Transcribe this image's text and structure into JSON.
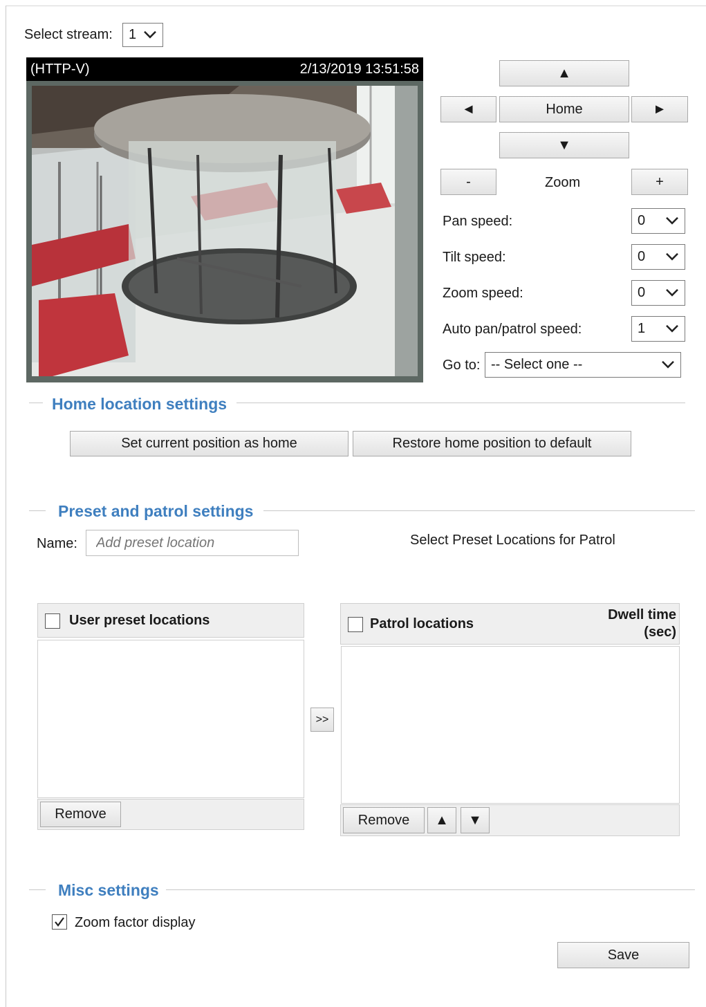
{
  "stream": {
    "label": "Select stream:",
    "selected": "1"
  },
  "video": {
    "protocol": "(HTTP-V)",
    "timestamp": "2/13/2019 13:51:58"
  },
  "ptz": {
    "up": "▲",
    "left": "◄",
    "home": "Home",
    "right": "►",
    "down": "▼",
    "zoom_out": "-",
    "zoom_label": "Zoom",
    "zoom_in": "+",
    "pan_speed_label": "Pan speed:",
    "pan_speed_value": "0",
    "tilt_speed_label": "Tilt speed:",
    "tilt_speed_value": "0",
    "zoom_speed_label": "Zoom speed:",
    "zoom_speed_value": "0",
    "auto_pan_label": "Auto pan/patrol speed:",
    "auto_pan_value": "1",
    "goto_label": "Go to:",
    "goto_value": "-- Select one --"
  },
  "home_settings": {
    "title": "Home location settings",
    "set_current": "Set current position as home",
    "restore_default": "Restore home position to default"
  },
  "preset_settings": {
    "title": "Preset and patrol settings",
    "name_label": "Name:",
    "name_placeholder": "Add preset location",
    "patrol_caption": "Select Preset Locations for Patrol",
    "user_presets_header": "User preset locations",
    "patrol_header": "Patrol locations",
    "dwell_line1": "Dwell time",
    "dwell_line2": "(sec)",
    "move_button": ">>",
    "remove_left": "Remove",
    "remove_right": "Remove",
    "move_up": "▲",
    "move_down": "▼"
  },
  "misc_settings": {
    "title": "Misc settings",
    "zoom_factor_label": "Zoom factor display",
    "zoom_factor_checked": true
  },
  "save_label": "Save"
}
